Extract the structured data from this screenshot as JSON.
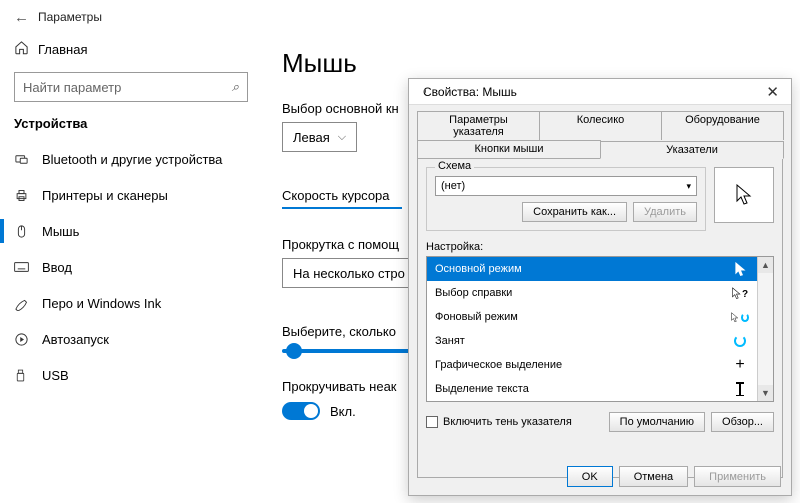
{
  "colors": {
    "accent": "#0078D4"
  },
  "titlebar": {
    "title": "Параметры"
  },
  "sidebar": {
    "home": "Главная",
    "search_placeholder": "Найти параметр",
    "section": "Устройства",
    "items": [
      {
        "label": "Bluetooth и другие устройства"
      },
      {
        "label": "Принтеры и сканеры"
      },
      {
        "label": "Мышь"
      },
      {
        "label": "Ввод"
      },
      {
        "label": "Перо и Windows Ink"
      },
      {
        "label": "Автозапуск"
      },
      {
        "label": "USB"
      }
    ]
  },
  "content": {
    "heading": "Мышь",
    "primary_button_label": "Выбор основной кн",
    "primary_button_value": "Левая",
    "cursor_speed_label": "Скорость курсора",
    "scroll_with_label": "Прокрутка с помощ",
    "scroll_with_value": "На несколько стро",
    "lines_label": "Выберите, сколько",
    "scroll_inactive_label": "Прокручивать неак",
    "toggle_on": "Вкл."
  },
  "dialog": {
    "title": "Свойства: Мышь",
    "tabs_row1": [
      "Параметры указателя",
      "Колесико",
      "Оборудование"
    ],
    "tabs_row2": [
      "Кнопки мыши",
      "Указатели"
    ],
    "scheme": {
      "group_label": "Схема",
      "value": "(нет)",
      "save_as": "Сохранить как...",
      "delete": "Удалить"
    },
    "settings_label": "Настройка:",
    "list": [
      "Основной режим",
      "Выбор справки",
      "Фоновый режим",
      "Занят",
      "Графическое выделение",
      "Выделение текста"
    ],
    "shadow_checkbox": "Включить тень указателя",
    "defaults_btn": "По умолчанию",
    "browse_btn": "Обзор...",
    "ok": "OK",
    "cancel": "Отмена",
    "apply": "Применить"
  }
}
